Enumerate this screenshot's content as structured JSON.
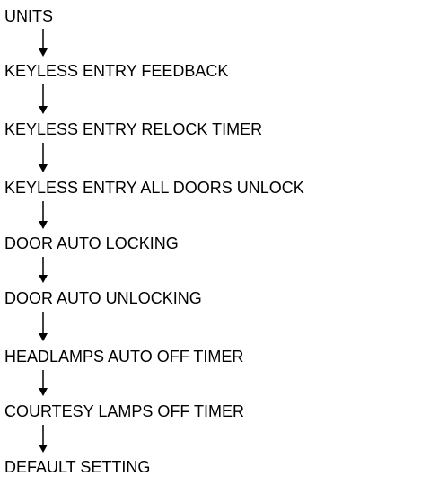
{
  "flowchart": {
    "steps": [
      "UNITS",
      "KEYLESS ENTRY FEEDBACK",
      "KEYLESS ENTRY RELOCK TIMER",
      "KEYLESS ENTRY ALL DOORS UNLOCK",
      "DOOR AUTO LOCKING",
      "DOOR AUTO UNLOCKING",
      "HEADLAMPS AUTO OFF TIMER",
      "COURTESY LAMPS OFF TIMER",
      "DEFAULT SETTING"
    ],
    "arrow_color": "#000000",
    "text_color": "#000000"
  }
}
